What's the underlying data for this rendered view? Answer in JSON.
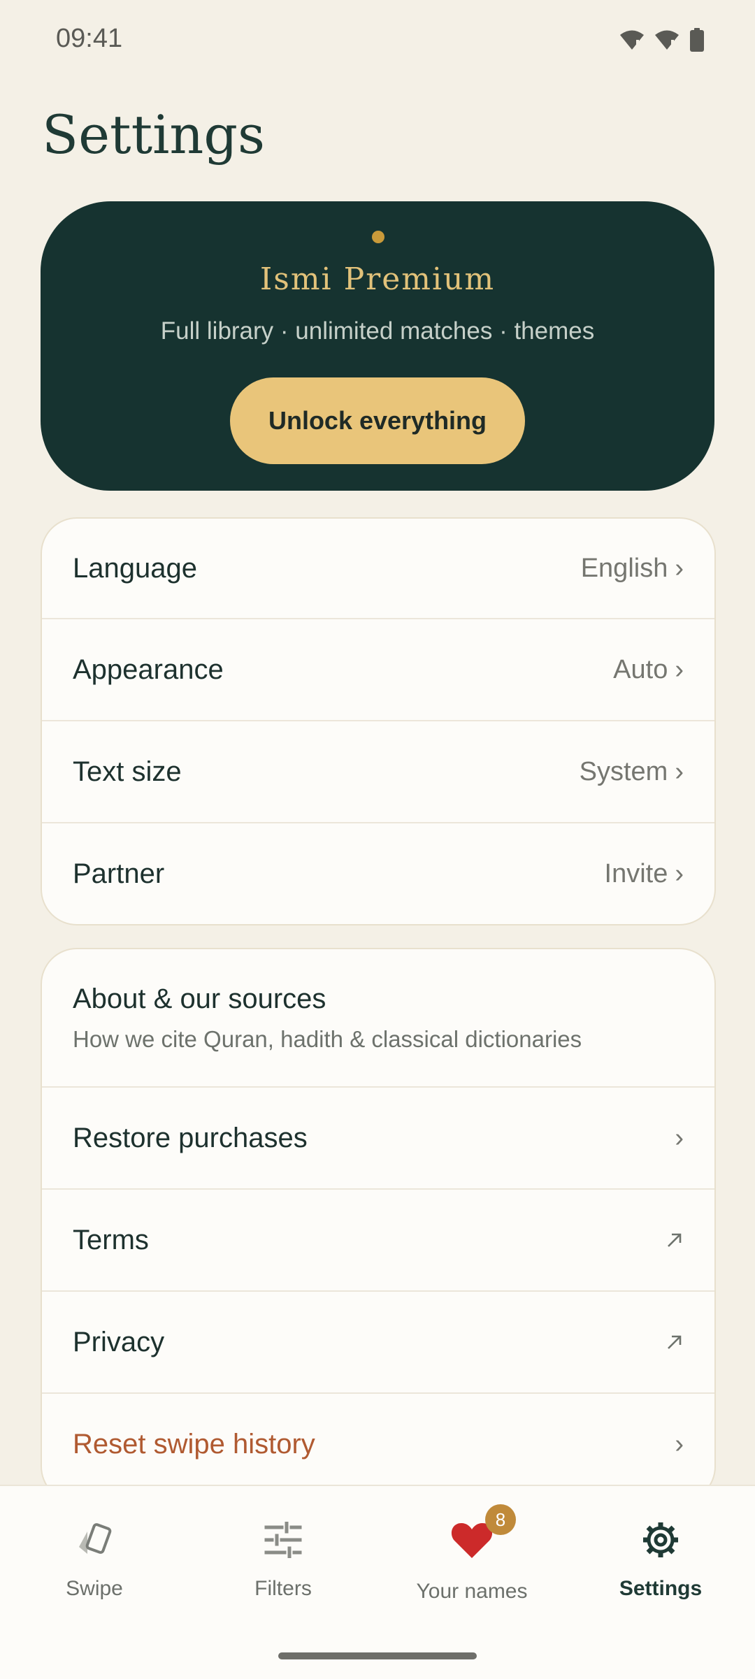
{
  "status_bar": {
    "time": "09:41"
  },
  "page": {
    "title": "Settings"
  },
  "premium": {
    "title": "Ismi Premium",
    "subtitle": "Full library · unlimited matches · themes",
    "button_label": "Unlock everything",
    "colors": {
      "card": "#163330",
      "accent": "#e9c57a",
      "dot": "#c99a3a"
    }
  },
  "settings_group_1": {
    "rows": [
      {
        "label": "Language",
        "value": "English",
        "icon": "chevron-right-icon"
      },
      {
        "label": "Appearance",
        "value": "Auto",
        "icon": "chevron-right-icon"
      },
      {
        "label": "Text size",
        "value": "System",
        "icon": "chevron-right-icon"
      },
      {
        "label": "Partner",
        "value": "Invite",
        "icon": "chevron-right-icon"
      }
    ]
  },
  "settings_group_2": {
    "rows": [
      {
        "label": "About & our sources",
        "sublabel": "How we cite Quran, hadith & classical dictionaries"
      },
      {
        "label": "Restore purchases",
        "icon": "chevron-right-icon"
      },
      {
        "label": "Terms",
        "icon": "external-link-icon"
      },
      {
        "label": "Privacy",
        "icon": "external-link-icon"
      },
      {
        "label": "Reset swipe history",
        "icon": "chevron-right-icon",
        "color": "#b05a31"
      }
    ]
  },
  "bottom_nav": {
    "items": [
      {
        "label": "Swipe",
        "icon": "swipe-cards-icon"
      },
      {
        "label": "Filters",
        "icon": "sliders-icon"
      },
      {
        "label": "Your names",
        "icon": "heart-icon",
        "badge": "8"
      },
      {
        "label": "Settings",
        "icon": "gear-icon",
        "active": true
      }
    ]
  },
  "chevron": "›"
}
